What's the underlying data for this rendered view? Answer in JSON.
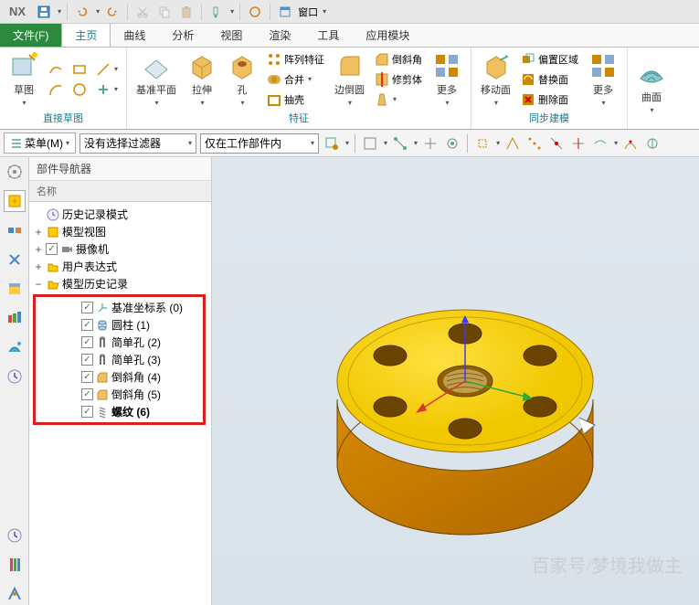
{
  "app": {
    "name": "NX"
  },
  "qat": {
    "window_menu": "窗口"
  },
  "tabs": {
    "file": "文件(F)",
    "items": [
      "主页",
      "曲线",
      "分析",
      "视图",
      "渲染",
      "工具",
      "应用模块"
    ],
    "active": 0
  },
  "ribbon": {
    "groups": {
      "sketch": {
        "label": "直接草图",
        "sketch_btn": "草图"
      },
      "feature": {
        "label": "特征",
        "datum": "基准平面",
        "extrude": "拉伸",
        "hole": "孔",
        "pattern": "阵列特征",
        "unite": "合并",
        "shell": "抽壳",
        "edgeblend": "边倒圆",
        "chamfer": "倒斜角",
        "trim": "修剪体",
        "more": "更多"
      },
      "sync": {
        "label": "同步建模",
        "move_face": "移动面",
        "offset_region": "偏置区域",
        "replace_face": "替换面",
        "delete_face": "删除面",
        "more": "更多"
      },
      "surface": {
        "surface": "曲面"
      }
    }
  },
  "filterbar": {
    "menu": "菜单(M)",
    "filter1": "没有选择过滤器",
    "filter2": "仅在工作部件内"
  },
  "nav": {
    "title": "部件导航器",
    "header": "名称",
    "nodes": {
      "history_mode": "历史记录模式",
      "model_views": "模型视图",
      "cameras": "摄像机",
      "expressions": "用户表达式",
      "model_history": "模型历史记录"
    },
    "features": [
      {
        "label": "基准坐标系 (0)",
        "icon": "csys"
      },
      {
        "label": "圆柱 (1)",
        "icon": "cylinder"
      },
      {
        "label": "简单孔 (2)",
        "icon": "hole"
      },
      {
        "label": "简单孔 (3)",
        "icon": "hole"
      },
      {
        "label": "倒斜角 (4)",
        "icon": "chamfer"
      },
      {
        "label": "倒斜角 (5)",
        "icon": "chamfer"
      },
      {
        "label": "螺纹 (6)",
        "icon": "thread"
      }
    ]
  },
  "watermark": {
    "top": "百家号/梦境我做主",
    "bottom": ""
  }
}
